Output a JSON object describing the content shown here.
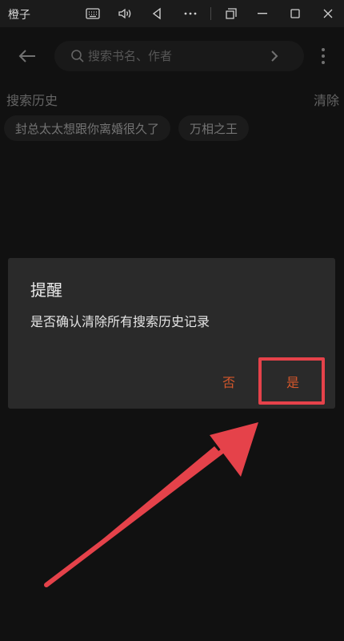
{
  "titlebar": {
    "app_title": "橙子",
    "icons": [
      "keyboard-icon",
      "volume-icon",
      "back-triangle-icon",
      "more-horizontal-icon",
      "window-restore-icon",
      "minimize-icon",
      "maximize-icon",
      "close-icon"
    ]
  },
  "search": {
    "placeholder": "搜索书名、作者"
  },
  "history": {
    "title": "搜索历史",
    "clear_label": "清除",
    "items": [
      "封总太太想跟你离婚很久了",
      "万相之王"
    ]
  },
  "dialog": {
    "title": "提醒",
    "message": "是否确认清除所有搜索历史记录",
    "cancel_label": "否",
    "confirm_label": "是"
  },
  "colors": {
    "background": "#151515",
    "dialog": "#2a2a2a",
    "accent": "#d4572b",
    "annotation": "#e5424a"
  }
}
